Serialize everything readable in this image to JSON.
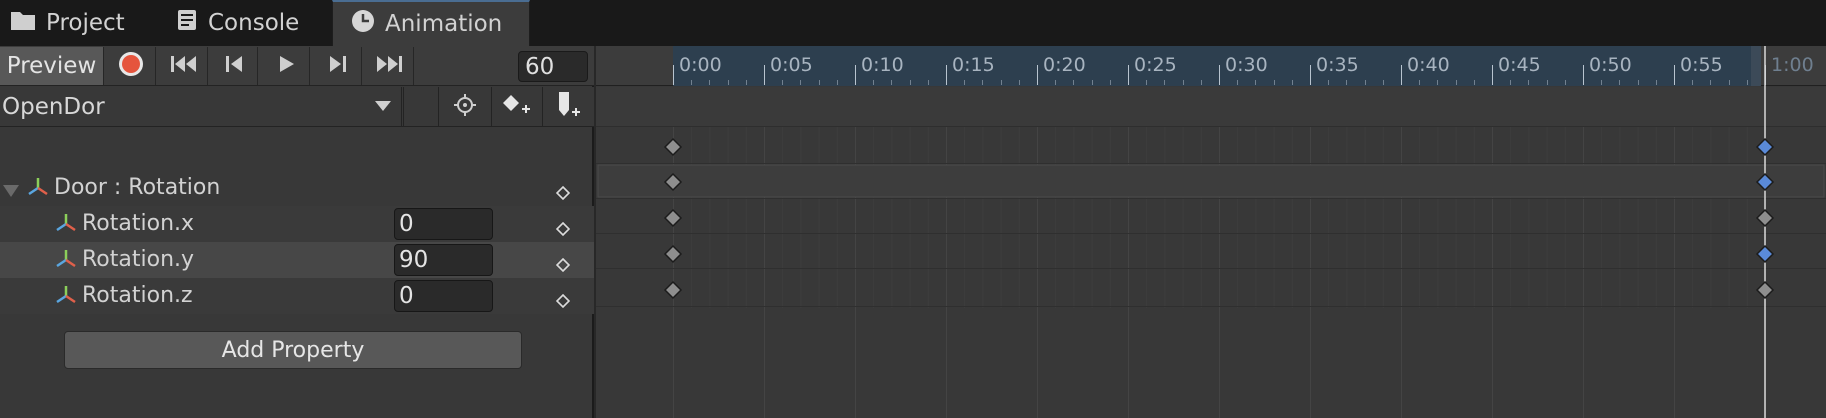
{
  "tabs": [
    {
      "label": "Project",
      "icon": "folder-icon"
    },
    {
      "label": "Console",
      "icon": "console-icon"
    },
    {
      "label": "Animation",
      "icon": "clock-icon",
      "active": true
    }
  ],
  "toolbar": {
    "preview_label": "Preview",
    "frame_value": "60",
    "record_color": "#e5543d"
  },
  "clip": {
    "name": "OpenDor"
  },
  "properties": {
    "group_label": "Door : Rotation",
    "rows": [
      {
        "label": "Rotation.x",
        "value": "0"
      },
      {
        "label": "Rotation.y",
        "value": "90"
      },
      {
        "label": "Rotation.z",
        "value": "0"
      }
    ]
  },
  "add_property_label": "Add Property",
  "timeline": {
    "ruler_labels": [
      "0:00",
      "0:05",
      "0:10",
      "0:15",
      "0:20",
      "0:25",
      "0:30",
      "0:35",
      "0:40",
      "0:45",
      "0:50",
      "0:55",
      "1:00"
    ],
    "keyframe_times": [
      "0:00",
      "1:00"
    ],
    "selected_key_color": "#5a8ad8",
    "key_color": "#8e8e8e",
    "playhead_time": "1:00"
  }
}
